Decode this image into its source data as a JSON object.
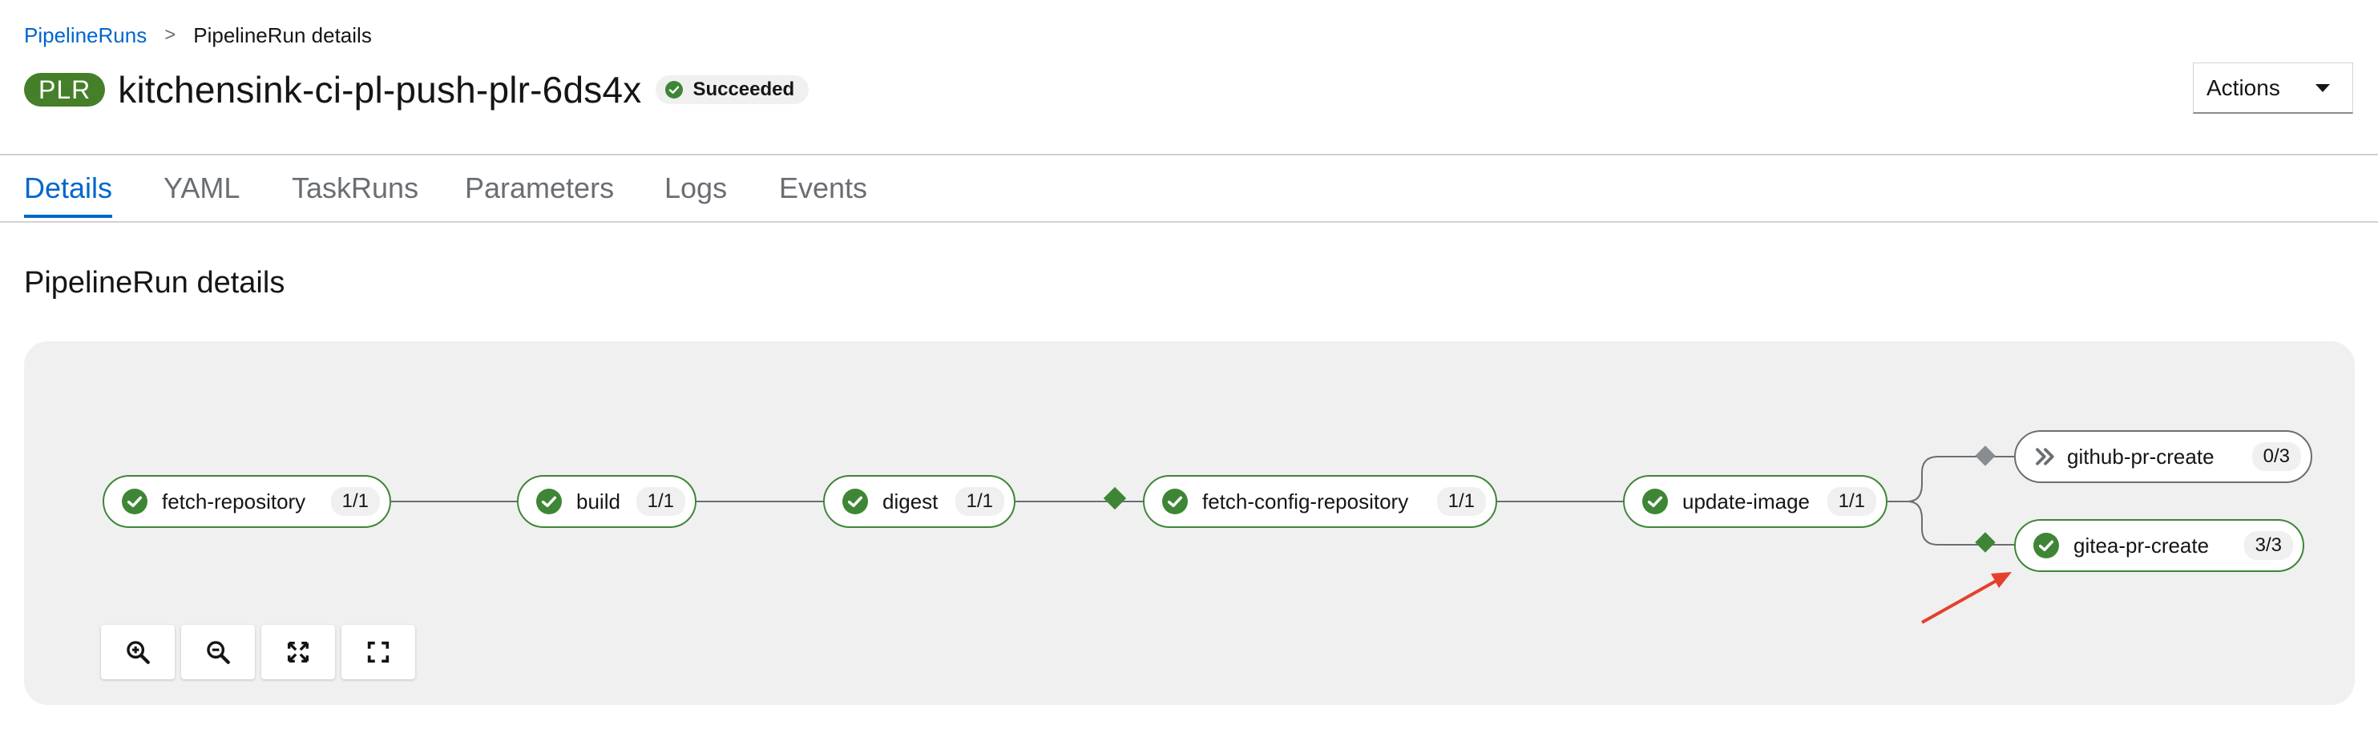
{
  "breadcrumb": {
    "parent": "PipelineRuns",
    "separator": ">",
    "current": "PipelineRun details"
  },
  "header": {
    "badge": "PLR",
    "title": "kitchensink-ci-pl-push-plr-6ds4x",
    "status": "Succeeded",
    "actions_label": "Actions"
  },
  "tabs": [
    "Details",
    "YAML",
    "TaskRuns",
    "Parameters",
    "Logs",
    "Events"
  ],
  "active_tab": "Details",
  "section_title": "PipelineRun details",
  "pipeline": {
    "tasks": [
      {
        "name": "fetch-repository",
        "count": "1/1",
        "status": "succeeded"
      },
      {
        "name": "build",
        "count": "1/1",
        "status": "succeeded"
      },
      {
        "name": "digest",
        "count": "1/1",
        "status": "succeeded"
      },
      {
        "name": "fetch-config-repository",
        "count": "1/1",
        "status": "succeeded"
      },
      {
        "name": "update-image",
        "count": "1/1",
        "status": "succeeded"
      },
      {
        "name": "github-pr-create",
        "count": "0/3",
        "status": "skipped"
      },
      {
        "name": "gitea-pr-create",
        "count": "3/3",
        "status": "succeeded"
      }
    ]
  },
  "zoom_controls": [
    "zoom-in-icon",
    "zoom-out-icon",
    "fit-to-screen-icon",
    "expand-icon"
  ],
  "colors": {
    "success": "#3e8635",
    "badge": "#467f2a",
    "link": "#0066cc",
    "annotation_arrow": "#e5402b"
  }
}
